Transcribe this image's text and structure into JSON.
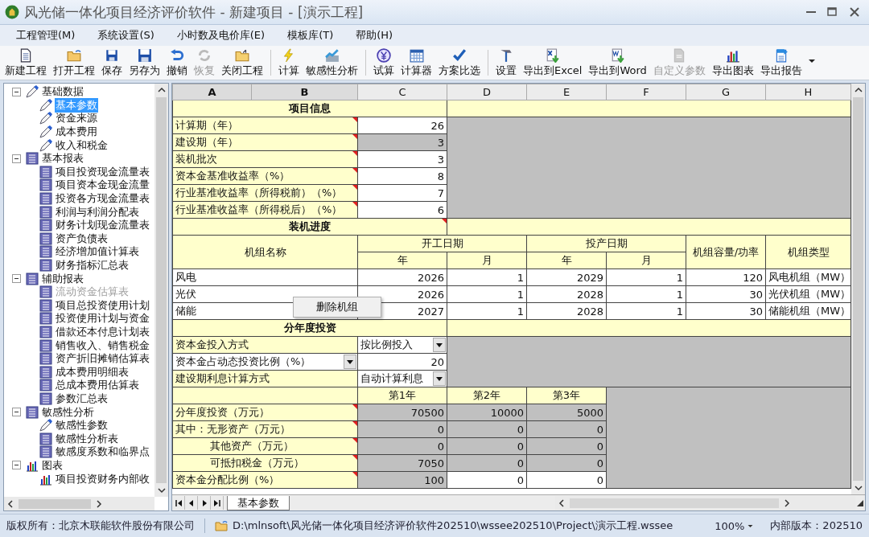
{
  "window": {
    "title": "风光储一体化项目经济评价软件 - 新建项目 - [演示工程]"
  },
  "menu": [
    {
      "label": "工程管理(M)"
    },
    {
      "label": "系统设置(S)"
    },
    {
      "label": "小时数及电价库(E)"
    },
    {
      "label": "模板库(T)"
    },
    {
      "label": "帮助(H)"
    }
  ],
  "toolbar": [
    [
      {
        "kind": "new",
        "label": "新建工程",
        "disabled": false
      },
      {
        "kind": "open",
        "label": "打开工程",
        "disabled": false
      },
      {
        "kind": "save",
        "label": "保存",
        "disabled": false
      },
      {
        "kind": "saveas",
        "label": "另存为",
        "disabled": false
      },
      {
        "kind": "undo",
        "label": "撤销",
        "disabled": false
      },
      {
        "kind": "redo",
        "label": "恢复",
        "disabled": true
      },
      {
        "kind": "close",
        "label": "关闭工程",
        "disabled": false
      }
    ],
    [
      {
        "kind": "calc",
        "label": "计算",
        "disabled": false
      },
      {
        "kind": "sens",
        "label": "敏感性分析",
        "disabled": false
      }
    ],
    [
      {
        "kind": "trial",
        "label": "试算",
        "disabled": false
      },
      {
        "kind": "calculator",
        "label": "计算器",
        "disabled": false
      },
      {
        "kind": "compare",
        "label": "方案比选",
        "disabled": false
      }
    ],
    [
      {
        "kind": "settings",
        "label": "设置",
        "disabled": false
      },
      {
        "kind": "excel",
        "label": "导出到Excel",
        "disabled": false
      },
      {
        "kind": "word",
        "label": "导出到Word",
        "disabled": false
      },
      {
        "kind": "custom",
        "label": "自定义参数",
        "disabled": true
      },
      {
        "kind": "chart",
        "label": "导出图表",
        "disabled": false
      },
      {
        "kind": "report",
        "label": "导出报告",
        "disabled": false
      }
    ]
  ],
  "tree": [
    {
      "label": "基础数据",
      "kind": "pencil",
      "expanded": true,
      "selected": false,
      "disabled": false,
      "children": [
        {
          "label": "基本参数",
          "kind": "pencil",
          "selected": true,
          "disabled": false
        },
        {
          "label": "资金来源",
          "kind": "pencil",
          "selected": false,
          "disabled": false
        },
        {
          "label": "成本费用",
          "kind": "pencil",
          "selected": false,
          "disabled": false
        },
        {
          "label": "收入和税金",
          "kind": "pencil",
          "selected": false,
          "disabled": false
        }
      ]
    },
    {
      "label": "基本报表",
      "kind": "report",
      "expanded": true,
      "selected": false,
      "disabled": false,
      "children": [
        {
          "label": "项目投资现金流量表",
          "kind": "report",
          "selected": false,
          "disabled": false
        },
        {
          "label": "项目资本金现金流量",
          "kind": "report",
          "selected": false,
          "disabled": false
        },
        {
          "label": "投资各方现金流量表",
          "kind": "report",
          "selected": false,
          "disabled": false
        },
        {
          "label": "利润与利润分配表",
          "kind": "report",
          "selected": false,
          "disabled": false
        },
        {
          "label": "财务计划现金流量表",
          "kind": "report",
          "selected": false,
          "disabled": false
        },
        {
          "label": "资产负债表",
          "kind": "report",
          "selected": false,
          "disabled": false
        },
        {
          "label": "经济增加值计算表",
          "kind": "report",
          "selected": false,
          "disabled": false
        },
        {
          "label": "财务指标汇总表",
          "kind": "report",
          "selected": false,
          "disabled": false
        }
      ]
    },
    {
      "label": "辅助报表",
      "kind": "report",
      "expanded": true,
      "selected": false,
      "disabled": false,
      "children": [
        {
          "label": "流动资金估算表",
          "kind": "report",
          "selected": false,
          "disabled": true
        },
        {
          "label": "项目总投资使用计划",
          "kind": "report",
          "selected": false,
          "disabled": false
        },
        {
          "label": "投资使用计划与资金",
          "kind": "report",
          "selected": false,
          "disabled": false
        },
        {
          "label": "借款还本付息计划表",
          "kind": "report",
          "selected": false,
          "disabled": false
        },
        {
          "label": "销售收入、销售税金",
          "kind": "report",
          "selected": false,
          "disabled": false
        },
        {
          "label": "资产折旧摊销估算表",
          "kind": "report",
          "selected": false,
          "disabled": false
        },
        {
          "label": "成本费用明细表",
          "kind": "report",
          "selected": false,
          "disabled": false
        },
        {
          "label": "总成本费用估算表",
          "kind": "report",
          "selected": false,
          "disabled": false
        },
        {
          "label": "参数汇总表",
          "kind": "report",
          "selected": false,
          "disabled": false
        }
      ]
    },
    {
      "label": "敏感性分析",
      "kind": "report",
      "expanded": true,
      "selected": false,
      "disabled": false,
      "children": [
        {
          "label": "敏感性参数",
          "kind": "pencil",
          "selected": false,
          "disabled": false
        },
        {
          "label": "敏感性分析表",
          "kind": "report",
          "selected": false,
          "disabled": false
        },
        {
          "label": "敏感度系数和临界点",
          "kind": "report",
          "selected": false,
          "disabled": false
        }
      ]
    },
    {
      "label": "图表",
      "kind": "chart",
      "expanded": true,
      "selected": false,
      "disabled": false,
      "children": [
        {
          "label": "项目投资财务内部收",
          "kind": "chart",
          "selected": false,
          "disabled": false
        }
      ]
    }
  ],
  "sheet": {
    "columns": [
      {
        "label": "A",
        "selected": true
      },
      {
        "label": "B",
        "selected": true
      },
      {
        "label": "C",
        "selected": false
      },
      {
        "label": "D",
        "selected": false
      },
      {
        "label": "E",
        "selected": false
      },
      {
        "label": "F",
        "selected": false
      },
      {
        "label": "G",
        "selected": false
      },
      {
        "label": "H",
        "selected": false
      }
    ],
    "rows": [
      [
        {
          "kind": "title",
          "text": "项目信息",
          "colspan": 3
        },
        {
          "kind": "band",
          "colspan": 5
        }
      ],
      [
        {
          "kind": "label",
          "text": "计算期（年）",
          "colspan": 2,
          "note": true
        },
        {
          "kind": "value",
          "text": "26"
        },
        {
          "kind": "blank",
          "colspan": 5,
          "rowspan": 6
        }
      ],
      [
        {
          "kind": "label",
          "text": "建设期（年）",
          "colspan": 2,
          "note": true
        },
        {
          "kind": "locked",
          "text": "3"
        }
      ],
      [
        {
          "kind": "label",
          "text": "装机批次",
          "colspan": 2,
          "note": true
        },
        {
          "kind": "value",
          "text": "3"
        }
      ],
      [
        {
          "kind": "label",
          "text": "资本金基准收益率（%）",
          "colspan": 2,
          "note": true
        },
        {
          "kind": "value",
          "text": "8"
        }
      ],
      [
        {
          "kind": "label",
          "text": "行业基准收益率（所得税前）（%）",
          "colspan": 2,
          "note": true
        },
        {
          "kind": "value",
          "text": "7"
        }
      ],
      [
        {
          "kind": "label",
          "text": "行业基准收益率（所得税后）（%）",
          "colspan": 2,
          "note": true
        },
        {
          "kind": "value",
          "text": "6"
        }
      ],
      [
        {
          "kind": "title",
          "text": "装机进度",
          "colspan": 3,
          "note": true
        },
        {
          "kind": "band",
          "colspan": 5
        }
      ],
      [
        {
          "kind": "head",
          "text": "机组名称",
          "colspan": 2,
          "rowspan": 2
        },
        {
          "kind": "head",
          "text": "开工日期",
          "colspan": 2
        },
        {
          "kind": "head",
          "text": "投产日期",
          "colspan": 2
        },
        {
          "kind": "head",
          "text": "机组容量/功率",
          "rowspan": 2
        },
        {
          "kind": "head",
          "text": "机组类型",
          "rowspan": 2
        }
      ],
      [
        {
          "kind": "head",
          "text": "年"
        },
        {
          "kind": "head",
          "text": "月"
        },
        {
          "kind": "head",
          "text": "年"
        },
        {
          "kind": "head",
          "text": "月"
        }
      ],
      [
        {
          "kind": "text",
          "text": "风电",
          "colspan": 2
        },
        {
          "kind": "value",
          "text": "2026"
        },
        {
          "kind": "value",
          "text": "1"
        },
        {
          "kind": "value",
          "text": "2029"
        },
        {
          "kind": "value",
          "text": "1"
        },
        {
          "kind": "value",
          "text": "120"
        },
        {
          "kind": "text",
          "text": "风电机组（MW）"
        }
      ],
      [
        {
          "kind": "text",
          "text": "光伏",
          "colspan": 2
        },
        {
          "kind": "value",
          "text": "2026"
        },
        {
          "kind": "value",
          "text": "1"
        },
        {
          "kind": "value",
          "text": "2028"
        },
        {
          "kind": "value",
          "text": "1"
        },
        {
          "kind": "value",
          "text": "30"
        },
        {
          "kind": "text",
          "text": "光伏机组（MW）"
        }
      ],
      [
        {
          "kind": "text",
          "text": "储能",
          "colspan": 2
        },
        {
          "kind": "value",
          "text": "2027"
        },
        {
          "kind": "value",
          "text": "1"
        },
        {
          "kind": "value",
          "text": "2028"
        },
        {
          "kind": "value",
          "text": "1"
        },
        {
          "kind": "value",
          "text": "30"
        },
        {
          "kind": "text",
          "text": "储能机组（MW）"
        }
      ],
      [
        {
          "kind": "title",
          "text": "分年度投资",
          "colspan": 3
        },
        {
          "kind": "band",
          "colspan": 5
        }
      ],
      [
        {
          "kind": "label",
          "text": "资本金投入方式",
          "colspan": 2
        },
        {
          "kind": "select",
          "text": "按比例投入"
        },
        {
          "kind": "blank",
          "colspan": 5,
          "rowspan": 3
        }
      ],
      [
        {
          "kind": "select",
          "text": "资本金占动态投资比例（%）",
          "colspan": 2
        },
        {
          "kind": "value",
          "text": "20"
        }
      ],
      [
        {
          "kind": "label",
          "text": "建设期利息计算方式",
          "colspan": 2
        },
        {
          "kind": "select",
          "text": "自动计算利息"
        }
      ],
      [
        {
          "kind": "band",
          "colspan": 2
        },
        {
          "kind": "head",
          "text": "第1年"
        },
        {
          "kind": "head",
          "text": "第2年"
        },
        {
          "kind": "head",
          "text": "第3年"
        },
        {
          "kind": "blank",
          "colspan": 3,
          "rowspan": 6
        }
      ],
      [
        {
          "kind": "label",
          "text": "分年度投资（万元）",
          "colspan": 2,
          "note": true
        },
        {
          "kind": "locked",
          "text": "70500"
        },
        {
          "kind": "locked",
          "text": "10000"
        },
        {
          "kind": "locked",
          "text": "5000"
        }
      ],
      [
        {
          "kind": "label",
          "text": "其中：无形资产（万元）",
          "colspan": 2,
          "note": true
        },
        {
          "kind": "locked",
          "text": "0"
        },
        {
          "kind": "locked",
          "text": "0"
        },
        {
          "kind": "locked",
          "text": "0"
        }
      ],
      [
        {
          "kind": "sublabel",
          "text": "其他资产（万元）",
          "colspan": 2,
          "note": true
        },
        {
          "kind": "locked",
          "text": "0"
        },
        {
          "kind": "locked",
          "text": "0"
        },
        {
          "kind": "locked",
          "text": "0"
        }
      ],
      [
        {
          "kind": "sublabel",
          "text": "可抵扣税金（万元）",
          "colspan": 2,
          "note": true
        },
        {
          "kind": "locked",
          "text": "7050"
        },
        {
          "kind": "locked",
          "text": "0"
        },
        {
          "kind": "locked",
          "text": "0"
        }
      ],
      [
        {
          "kind": "label",
          "text": "资本金分配比例（%）",
          "colspan": 2,
          "note": true
        },
        {
          "kind": "locked",
          "text": "100"
        },
        {
          "kind": "value",
          "text": "0"
        },
        {
          "kind": "value",
          "text": "0"
        }
      ]
    ]
  },
  "context_menu": {
    "items": [
      {
        "label": "删除机组"
      }
    ]
  },
  "sheet_tabs": [
    {
      "label": "基本参数",
      "selected": true
    }
  ],
  "status_bar": {
    "copyright": "版权所有：北京木联能软件股份有限公司",
    "path": "D:\\mlnsoft\\风光储一体化项目经济评价软件202510\\wssee202510\\Project\\演示工程.wssee",
    "zoom": "100%",
    "version": "内部版本：202510"
  }
}
